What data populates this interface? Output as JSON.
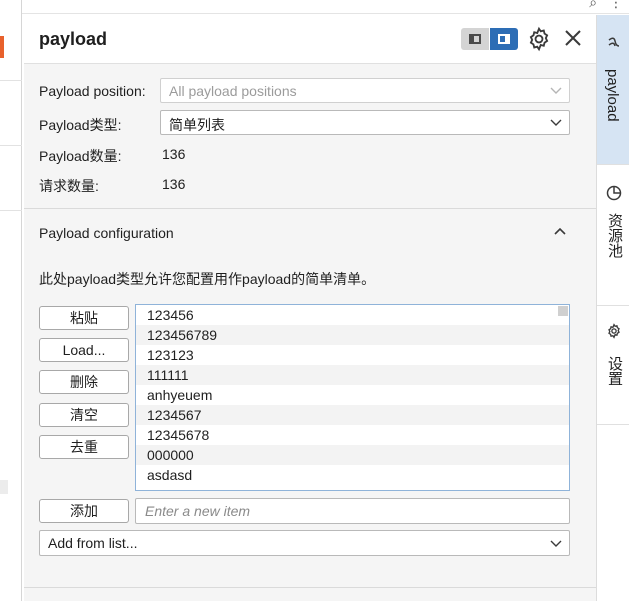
{
  "panel": {
    "title": "payload",
    "fields": {
      "position_label": "Payload position:",
      "position_value": "All payload positions",
      "type_label": "Payload类型:",
      "type_value": "简单列表",
      "count_label": "Payload数量:",
      "count_value": "136",
      "requests_label": "请求数量:",
      "requests_value": "136"
    },
    "config": {
      "title": "Payload configuration",
      "description": "此处payload类型允许您配置用作payload的简单清单。",
      "buttons": {
        "paste": "粘贴",
        "load": "Load...",
        "remove": "删除",
        "clear": "清空",
        "dedupe": "去重",
        "add": "添加"
      },
      "items": [
        "123456",
        "123456789",
        "123123",
        "111111",
        "anhyeuem",
        "1234567",
        "12345678",
        "000000",
        "asdasd"
      ],
      "add_placeholder": "Enter a new item",
      "add_from_list": "Add from list..."
    }
  },
  "rail": {
    "tabs": [
      {
        "label": "payload",
        "icon": "payload-icon",
        "active": true
      },
      {
        "label": "资源池",
        "icon": "pie-chart-icon",
        "active": false
      },
      {
        "label": "设置",
        "icon": "gear-icon",
        "active": false
      }
    ]
  },
  "colors": {
    "accent": "#2d6db5",
    "active_tab": "#d6e4f3",
    "panel_bg": "#f5f5f5",
    "list_border": "#8fb3d9",
    "left_marker": "#e8612c"
  }
}
